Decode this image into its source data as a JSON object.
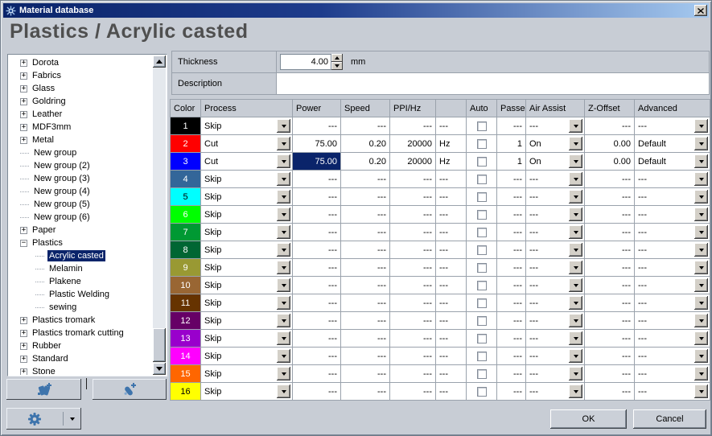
{
  "window": {
    "title": "Material database"
  },
  "header": {
    "title": "Plastics / Acrylic casted"
  },
  "colors": {
    "selection": "#0A246A",
    "titlebar_left": "#0A246A",
    "titlebar_right": "#A6CAF0",
    "icon_accent": "#3E74AC"
  },
  "form": {
    "thickness_label": "Thickness",
    "thickness_value": "4.00",
    "thickness_unit": "mm",
    "description_label": "Description",
    "description_value": ""
  },
  "tree": {
    "items": [
      {
        "label": "Dorota",
        "toggle": "+",
        "indent": 0,
        "selected": false
      },
      {
        "label": "Fabrics",
        "toggle": "+",
        "indent": 0,
        "selected": false
      },
      {
        "label": "Glass",
        "toggle": "+",
        "indent": 0,
        "selected": false
      },
      {
        "label": "Goldring",
        "toggle": "+",
        "indent": 0,
        "selected": false
      },
      {
        "label": "Leather",
        "toggle": "+",
        "indent": 0,
        "selected": false
      },
      {
        "label": "MDF3mm",
        "toggle": "+",
        "indent": 0,
        "selected": false
      },
      {
        "label": "Metal",
        "toggle": "+",
        "indent": 0,
        "selected": false
      },
      {
        "label": "New group",
        "toggle": null,
        "indent": 0,
        "selected": false
      },
      {
        "label": "New group (2)",
        "toggle": null,
        "indent": 0,
        "selected": false
      },
      {
        "label": "New group (3)",
        "toggle": null,
        "indent": 0,
        "selected": false
      },
      {
        "label": "New group (4)",
        "toggle": null,
        "indent": 0,
        "selected": false
      },
      {
        "label": "New group (5)",
        "toggle": null,
        "indent": 0,
        "selected": false
      },
      {
        "label": "New group (6)",
        "toggle": null,
        "indent": 0,
        "selected": false
      },
      {
        "label": "Paper",
        "toggle": "+",
        "indent": 0,
        "selected": false
      },
      {
        "label": "Plastics",
        "toggle": "-",
        "indent": 0,
        "selected": false
      },
      {
        "label": "Acrylic casted",
        "toggle": null,
        "indent": 1,
        "selected": true
      },
      {
        "label": "Melamin",
        "toggle": null,
        "indent": 1,
        "selected": false
      },
      {
        "label": "Plakene",
        "toggle": null,
        "indent": 1,
        "selected": false
      },
      {
        "label": "Plastic Welding",
        "toggle": null,
        "indent": 1,
        "selected": false
      },
      {
        "label": "sewing",
        "toggle": null,
        "indent": 1,
        "selected": false
      },
      {
        "label": "Plastics tromark",
        "toggle": "+",
        "indent": 0,
        "selected": false
      },
      {
        "label": "Plastics tromark cutting",
        "toggle": "+",
        "indent": 0,
        "selected": false
      },
      {
        "label": "Rubber",
        "toggle": "+",
        "indent": 0,
        "selected": false
      },
      {
        "label": "Standard",
        "toggle": "+",
        "indent": 0,
        "selected": false
      },
      {
        "label": "Stone",
        "toggle": "+",
        "indent": 0,
        "selected": false
      }
    ]
  },
  "table": {
    "columns": [
      "Color",
      "Process",
      "Power",
      "Speed",
      "PPI/Hz",
      "",
      "Auto",
      "Passes",
      "Air Assist",
      "Z-Offset",
      "Advanced"
    ],
    "rows": [
      {
        "num": "1",
        "color": "#000000",
        "text": "#FFFFFF",
        "process": "Skip",
        "power": "---",
        "speed": "---",
        "ppi": "---",
        "unit": "---",
        "auto": false,
        "passes": "---",
        "air": "---",
        "z": "---",
        "adv": "---",
        "power_selected": false
      },
      {
        "num": "2",
        "color": "#FF0000",
        "text": "#FFFFFF",
        "process": "Cut",
        "power": "75.00",
        "speed": "0.20",
        "ppi": "20000",
        "unit": "Hz",
        "auto": false,
        "passes": "1",
        "air": "On",
        "z": "0.00",
        "adv": "Default",
        "power_selected": false
      },
      {
        "num": "3",
        "color": "#0000FF",
        "text": "#FFFFFF",
        "process": "Cut",
        "power": "75.00",
        "speed": "0.20",
        "ppi": "20000",
        "unit": "Hz",
        "auto": false,
        "passes": "1",
        "air": "On",
        "z": "0.00",
        "adv": "Default",
        "power_selected": true
      },
      {
        "num": "4",
        "color": "#336699",
        "text": "#FFFFFF",
        "process": "Skip",
        "power": "---",
        "speed": "---",
        "ppi": "---",
        "unit": "---",
        "auto": false,
        "passes": "---",
        "air": "---",
        "z": "---",
        "adv": "---",
        "power_selected": false
      },
      {
        "num": "5",
        "color": "#00FFFF",
        "text": "#000000",
        "process": "Skip",
        "power": "---",
        "speed": "---",
        "ppi": "---",
        "unit": "---",
        "auto": false,
        "passes": "---",
        "air": "---",
        "z": "---",
        "adv": "---",
        "power_selected": false
      },
      {
        "num": "6",
        "color": "#00FF00",
        "text": "#FFFFFF",
        "process": "Skip",
        "power": "---",
        "speed": "---",
        "ppi": "---",
        "unit": "---",
        "auto": false,
        "passes": "---",
        "air": "---",
        "z": "---",
        "adv": "---",
        "power_selected": false
      },
      {
        "num": "7",
        "color": "#009933",
        "text": "#FFFFFF",
        "process": "Skip",
        "power": "---",
        "speed": "---",
        "ppi": "---",
        "unit": "---",
        "auto": false,
        "passes": "---",
        "air": "---",
        "z": "---",
        "adv": "---",
        "power_selected": false
      },
      {
        "num": "8",
        "color": "#006633",
        "text": "#FFFFFF",
        "process": "Skip",
        "power": "---",
        "speed": "---",
        "ppi": "---",
        "unit": "---",
        "auto": false,
        "passes": "---",
        "air": "---",
        "z": "---",
        "adv": "---",
        "power_selected": false
      },
      {
        "num": "9",
        "color": "#999933",
        "text": "#FFFFFF",
        "process": "Skip",
        "power": "---",
        "speed": "---",
        "ppi": "---",
        "unit": "---",
        "auto": false,
        "passes": "---",
        "air": "---",
        "z": "---",
        "adv": "---",
        "power_selected": false
      },
      {
        "num": "10",
        "color": "#996633",
        "text": "#FFFFFF",
        "process": "Skip",
        "power": "---",
        "speed": "---",
        "ppi": "---",
        "unit": "---",
        "auto": false,
        "passes": "---",
        "air": "---",
        "z": "---",
        "adv": "---",
        "power_selected": false
      },
      {
        "num": "11",
        "color": "#663300",
        "text": "#FFFFFF",
        "process": "Skip",
        "power": "---",
        "speed": "---",
        "ppi": "---",
        "unit": "---",
        "auto": false,
        "passes": "---",
        "air": "---",
        "z": "---",
        "adv": "---",
        "power_selected": false
      },
      {
        "num": "12",
        "color": "#660066",
        "text": "#FFFFFF",
        "process": "Skip",
        "power": "---",
        "speed": "---",
        "ppi": "---",
        "unit": "---",
        "auto": false,
        "passes": "---",
        "air": "---",
        "z": "---",
        "adv": "---",
        "power_selected": false
      },
      {
        "num": "13",
        "color": "#9900CC",
        "text": "#FFFFFF",
        "process": "Skip",
        "power": "---",
        "speed": "---",
        "ppi": "---",
        "unit": "---",
        "auto": false,
        "passes": "---",
        "air": "---",
        "z": "---",
        "adv": "---",
        "power_selected": false
      },
      {
        "num": "14",
        "color": "#FF00FF",
        "text": "#FFFFFF",
        "process": "Skip",
        "power": "---",
        "speed": "---",
        "ppi": "---",
        "unit": "---",
        "auto": false,
        "passes": "---",
        "air": "---",
        "z": "---",
        "adv": "---",
        "power_selected": false
      },
      {
        "num": "15",
        "color": "#FF6600",
        "text": "#FFFFFF",
        "process": "Skip",
        "power": "---",
        "speed": "---",
        "ppi": "---",
        "unit": "---",
        "auto": false,
        "passes": "---",
        "air": "---",
        "z": "---",
        "adv": "---",
        "power_selected": false
      },
      {
        "num": "16",
        "color": "#FFFF00",
        "text": "#000000",
        "process": "Skip",
        "power": "---",
        "speed": "---",
        "ppi": "---",
        "unit": "---",
        "auto": false,
        "passes": "---",
        "air": "---",
        "z": "---",
        "adv": "---",
        "power_selected": false
      }
    ]
  },
  "toolbar": {
    "add_group_icon": "swatch-plus-icon",
    "add_material_icon": "pen-plus-icon",
    "settings_icon": "gear-icon",
    "dropdown_icon": "chevron-down-icon"
  },
  "footer": {
    "ok_label": "OK",
    "cancel_label": "Cancel"
  }
}
